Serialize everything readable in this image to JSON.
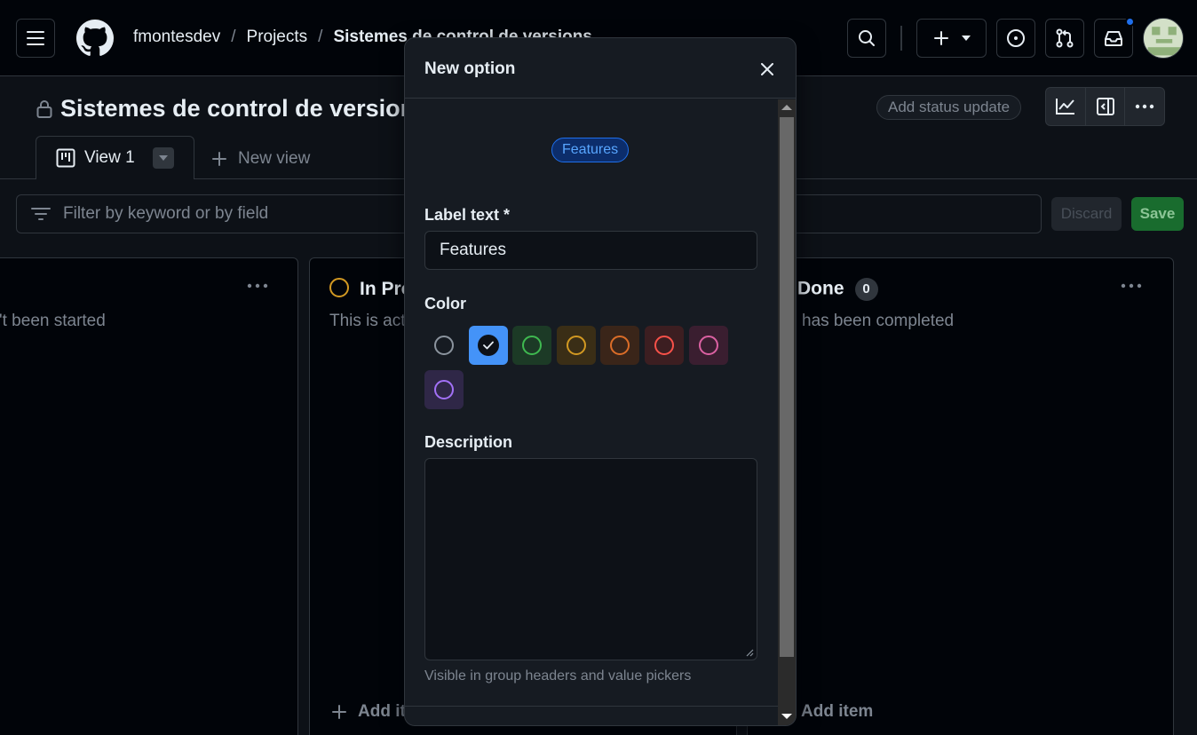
{
  "header": {
    "breadcrumb": [
      "fmontesdev",
      "Projects",
      "Sistemes de control de versions"
    ],
    "separator": "/"
  },
  "project": {
    "title": "Sistemes de control de versions",
    "status_update": "Add status update"
  },
  "tabs": {
    "active": "View 1",
    "new_view": "New view"
  },
  "filter": {
    "placeholder": "Filter by keyword or by field",
    "discard": "Discard",
    "save": "Save"
  },
  "columns": [
    {
      "title": "",
      "description": "'t been started",
      "add": ""
    },
    {
      "title": "In Pro",
      "description": "This is act",
      "add": "Add it"
    },
    {
      "title": "Done",
      "count": "0",
      "description": "has been completed",
      "add": "Add item"
    }
  ],
  "dialog": {
    "title": "New option",
    "preview": "Features",
    "label_text_label": "Label text *",
    "label_value": "Features",
    "color_label": "Color",
    "selected_color": "blue",
    "colors": [
      {
        "name": "gray",
        "ring": "#8b949e",
        "bg": "transparent"
      },
      {
        "name": "blue",
        "ring": "#ffffff",
        "bg": "#4493f8"
      },
      {
        "name": "green",
        "ring": "#3fb950",
        "bg": "#1c3a26"
      },
      {
        "name": "yellow",
        "ring": "#d29922",
        "bg": "#3a2e16"
      },
      {
        "name": "orange",
        "ring": "#db6d28",
        "bg": "#3a2519"
      },
      {
        "name": "red",
        "ring": "#f85149",
        "bg": "#3c1e21"
      },
      {
        "name": "pink",
        "ring": "#db61a2",
        "bg": "#3a1e30"
      },
      {
        "name": "purple",
        "ring": "#a371f7",
        "bg": "#2f2747"
      }
    ],
    "description_label": "Description",
    "description_value": "",
    "hint": "Visible in group headers and value pickers"
  }
}
